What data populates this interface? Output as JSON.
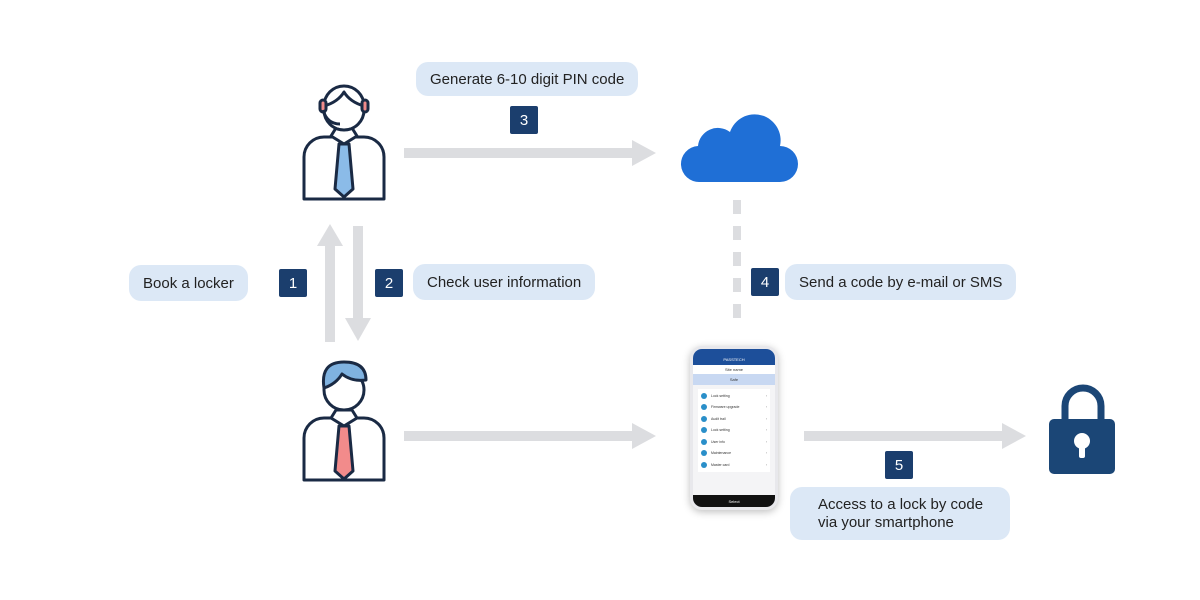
{
  "steps": [
    {
      "number": "1",
      "label": "Book a locker"
    },
    {
      "number": "2",
      "label": "Check user information"
    },
    {
      "number": "3",
      "label": "Generate 6-10 digit PIN code"
    },
    {
      "number": "4",
      "label": "Send a code by e-mail or SMS"
    },
    {
      "number": "5",
      "label_line1": "Access to a lock by code",
      "label_line2": "via your smartphone"
    }
  ],
  "phone": {
    "brand": "PASSTECH",
    "site": "Site name",
    "section": "Safe",
    "items": [
      "Lock setting",
      "Firmware upgrade",
      "Audit trail",
      "Lock setting",
      "User info",
      "Maintenance",
      "Master card"
    ],
    "footer": "Select"
  },
  "colors": {
    "badge": "#1b3e6d",
    "bubble": "#dce8f6",
    "arrow": "#dcdde0",
    "cloud": "#1f6fd6",
    "lock": "#1b4676"
  }
}
